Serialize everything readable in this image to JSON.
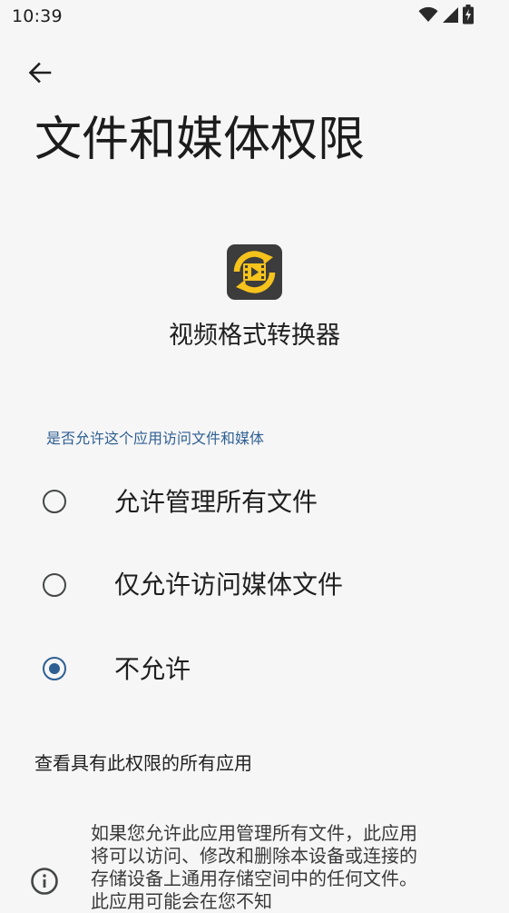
{
  "status_bar": {
    "time": "10:39"
  },
  "header": {
    "title": "文件和媒体权限"
  },
  "app": {
    "name": "视频格式转换器"
  },
  "permission": {
    "question": "是否允许这个应用访问文件和媒体",
    "options": [
      {
        "label": "允许管理所有文件",
        "selected": false
      },
      {
        "label": "仅允许访问媒体文件",
        "selected": false
      },
      {
        "label": "不允许",
        "selected": true
      }
    ]
  },
  "see_all_link": "查看具有此权限的所有应用",
  "info": {
    "text": "如果您允许此应用管理所有文件，此应用将可以访问、修改和删除本设备或连接的存储设备上通用存储空间中的任何文件。此应用可能会在您不知"
  },
  "colors": {
    "background": "#f6f6f6",
    "accent": "#2e5f93",
    "icon_yellow": "#f6c21c",
    "icon_dark": "#3c3c3c"
  },
  "icons": {
    "wifi": "wifi-icon",
    "signal": "cellular-signal-icon",
    "battery": "battery-charging-icon",
    "back": "arrow-back-icon",
    "app": "video-converter-app-icon",
    "info": "info-icon"
  }
}
